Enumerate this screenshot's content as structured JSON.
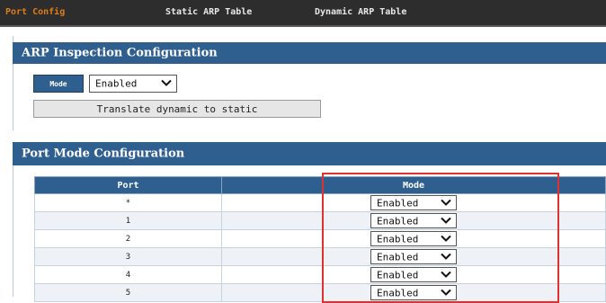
{
  "nav": {
    "tabs": [
      {
        "label": "Port Config",
        "active": true
      },
      {
        "label": "Static ARP Table",
        "active": false
      },
      {
        "label": "Dynamic ARP Table",
        "active": false
      }
    ]
  },
  "arp_section": {
    "title": "ARP Inspection Configuration",
    "mode_label": "Mode",
    "mode_value": "Enabled",
    "translate_button": "Translate dynamic to static"
  },
  "port_section": {
    "title": "Port Mode Configuration",
    "columns": [
      "Port",
      "Mode"
    ],
    "rows": [
      {
        "port": "*",
        "mode": "Enabled"
      },
      {
        "port": "1",
        "mode": "Enabled"
      },
      {
        "port": "2",
        "mode": "Enabled"
      },
      {
        "port": "3",
        "mode": "Enabled"
      },
      {
        "port": "4",
        "mode": "Enabled"
      },
      {
        "port": "5",
        "mode": "Enabled"
      }
    ]
  },
  "colors": {
    "header_bar": "#2f5f8f",
    "active_tab": "#e07b1a",
    "highlight": "#e03030"
  },
  "icons": {
    "dropdown": "chevron-down-icon"
  }
}
